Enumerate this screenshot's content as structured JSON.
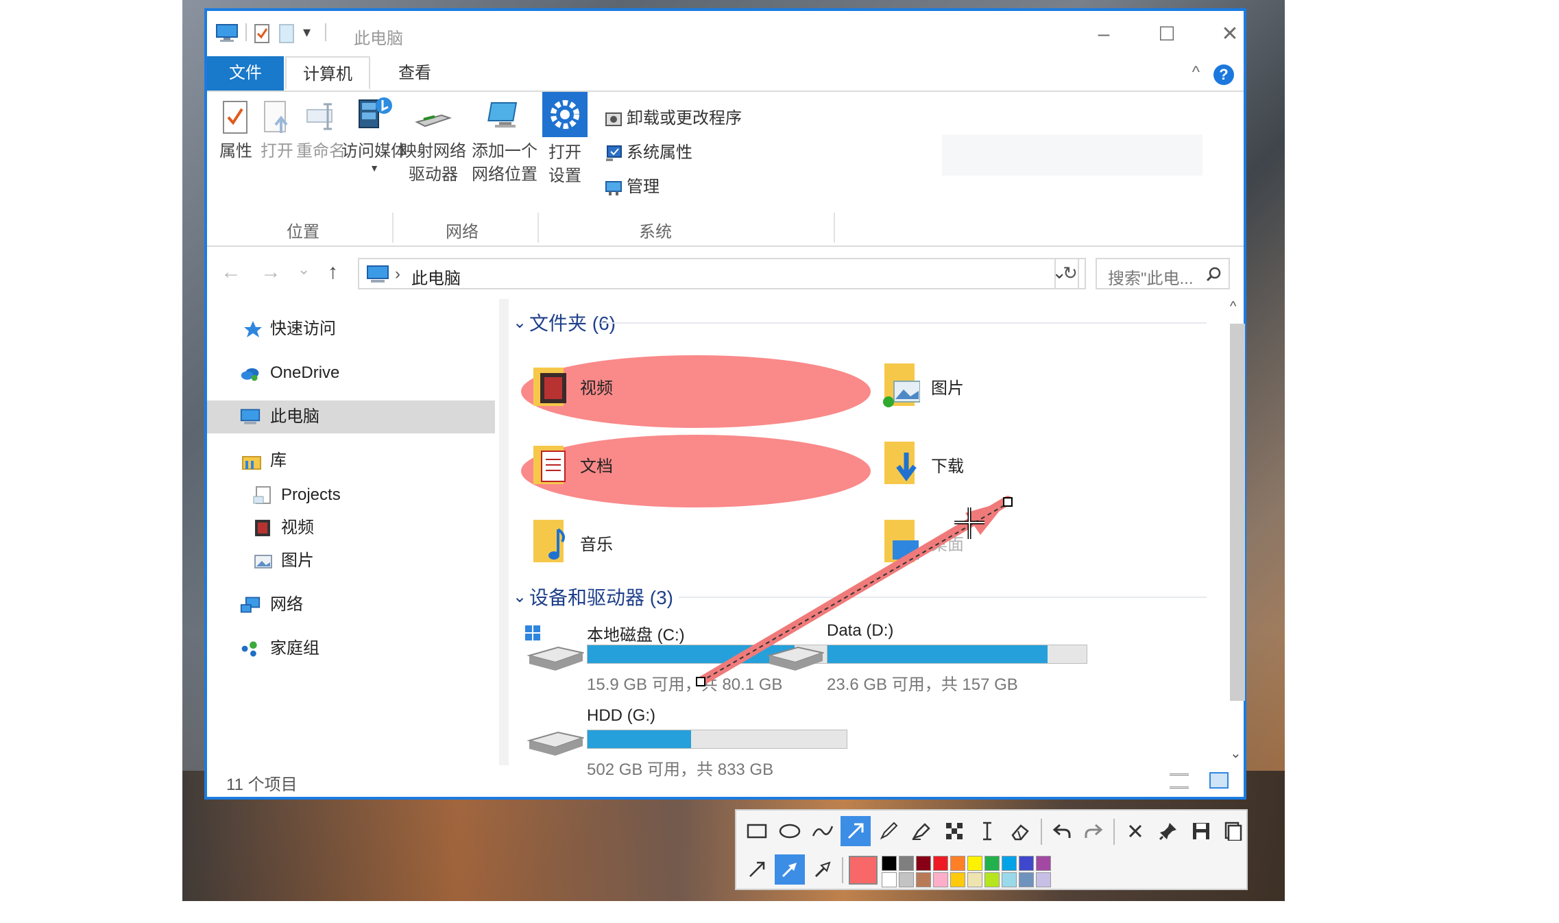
{
  "window": {
    "title": "此电脑",
    "qat_arrow": "▾",
    "minimize": "–",
    "maximize": "☐",
    "close": "✕",
    "help": "?",
    "collapse": "^"
  },
  "ribbon": {
    "tabs": {
      "file": "文件",
      "computer": "计算机",
      "view": "查看"
    },
    "buttons": {
      "properties": "属性",
      "open": "打开",
      "rename": "重命名",
      "access_media": "访问媒体",
      "map_drive_1": "映射网络",
      "map_drive_2": "驱动器",
      "add_location_1": "添加一个",
      "add_location_2": "网络位置",
      "open_settings_1": "打开",
      "open_settings_2": "设置",
      "uninstall": "卸载或更改程序",
      "system_props": "系统属性",
      "manage": "管理"
    },
    "groups": {
      "location": "位置",
      "network": "网络",
      "system": "系统"
    }
  },
  "address": {
    "path": "此电脑",
    "separator": "›",
    "search_placeholder": "搜索\"此电...",
    "refresh": "↻",
    "back": "←",
    "forward": "→",
    "recent": "⌄",
    "up": "↑",
    "dropdown": "⌄"
  },
  "nav": {
    "quick_access": "快速访问",
    "onedrive": "OneDrive",
    "this_pc": "此电脑",
    "library": "库",
    "projects": "Projects",
    "videos": "视频",
    "pictures": "图片",
    "network": "网络",
    "homegroup": "家庭组"
  },
  "content": {
    "folders_header": "文件夹 (6)",
    "devices_header": "设备和驱动器 (3)",
    "folders": {
      "videos": "视频",
      "pictures": "图片",
      "documents": "文档",
      "downloads": "下载",
      "music": "音乐",
      "desktop": "桌面"
    },
    "drives": [
      {
        "name": "本地磁盘 (C:)",
        "size": "15.9 GB 可用，共 80.1 GB",
        "used_fraction": 0.8
      },
      {
        "name": "Data (D:)",
        "size": "23.6 GB 可用，共 157 GB",
        "used_fraction": 0.85
      },
      {
        "name": "HDD (G:)",
        "size": "502 GB 可用，共 833 GB",
        "used_fraction": 0.4
      }
    ]
  },
  "status": {
    "count": "11 个项目"
  },
  "colors": {
    "accent": "#1b7be0",
    "highlight": "#f86868",
    "drive_fill": "#26a0da",
    "palette": [
      "#000000",
      "#7f7f7f",
      "#880015",
      "#ed1c24",
      "#ff7f27",
      "#fff200",
      "#22b14c",
      "#00a2e8",
      "#3f48cc",
      "#a349a4",
      "#ffffff",
      "#c3c3c3",
      "#b97a57",
      "#ffaec9",
      "#ffc90e",
      "#efe4b0",
      "#b5e61d",
      "#99d9ea",
      "#7092be",
      "#c8bfe7"
    ]
  }
}
